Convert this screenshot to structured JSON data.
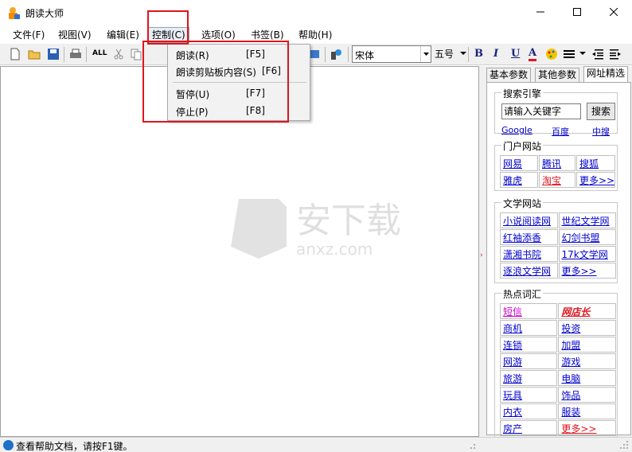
{
  "window": {
    "title": "朗读大师"
  },
  "menubar": {
    "items": [
      "文件(F)",
      "视图(V)",
      "编辑(E)",
      "控制(C)",
      "选项(O)",
      "书签(B)",
      "帮助(H)"
    ]
  },
  "toolbar": {
    "all_label": "ALL",
    "font_name": "宋体",
    "font_size": "五号",
    "bold": "B",
    "italic": "I",
    "underline": "U",
    "color": "A"
  },
  "dropdown": {
    "items": [
      {
        "label": "朗读(R)",
        "key": "[F5]"
      },
      {
        "label": "朗读剪贴板内容(S)",
        "key": "[F6]"
      },
      {
        "label": "暂停(U)",
        "key": "[F7]"
      },
      {
        "label": "停止(P)",
        "key": "[F8]"
      }
    ]
  },
  "panel": {
    "tabs": [
      "基本参数",
      "其他参数",
      "网址精选"
    ],
    "search": {
      "title": "搜索引擎",
      "placeholder": "请输入关键字",
      "button": "搜索",
      "engines": [
        "Google",
        "百度",
        "中搜"
      ]
    },
    "portal": {
      "title": "门户网站",
      "links": [
        "网易",
        "腾讯",
        "搜狐",
        "雅虎",
        "淘宝",
        "更多>>"
      ]
    },
    "literature": {
      "title": "文学网站",
      "links": [
        "小说阅读网",
        "世纪文学网",
        "红袖添香",
        "幻剑书盟",
        "潇湘书院",
        "17k文学网",
        "逐浪文学网",
        "更多>>"
      ]
    },
    "hot": {
      "title": "热点词汇",
      "links": [
        "短信",
        "网店长",
        "商机",
        "投资",
        "连锁",
        "加盟",
        "网游",
        "游戏",
        "旅游",
        "电脑",
        "玩具",
        "饰品",
        "内衣",
        "服装",
        "房产",
        "更多>>"
      ]
    }
  },
  "statusbar": {
    "text": "查看帮助文档，请按F1键。"
  },
  "watermark": {
    "text": "安下载",
    "sub": "anxz.com"
  }
}
